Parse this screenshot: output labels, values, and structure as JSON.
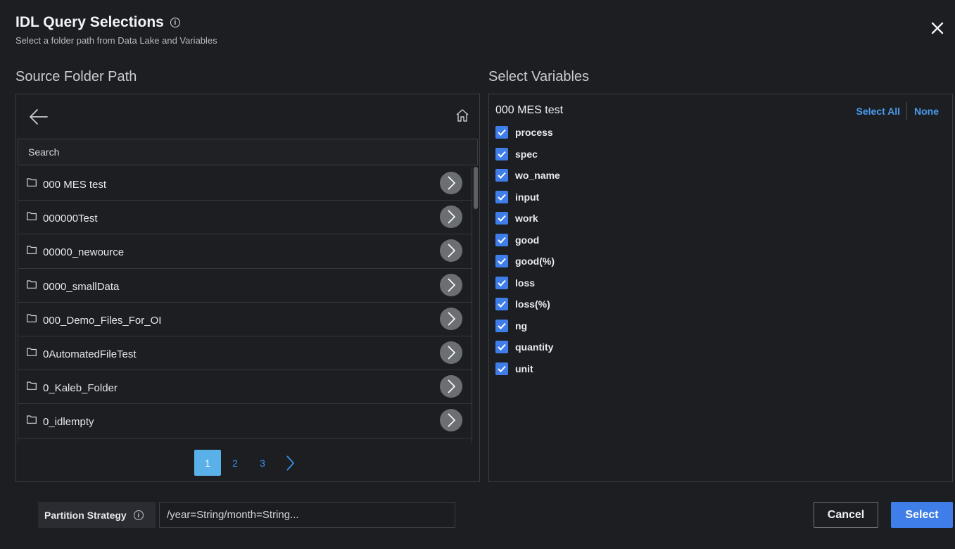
{
  "header": {
    "title": "IDL Query Selections",
    "subtitle": "Select a folder path from Data Lake and Variables"
  },
  "source": {
    "section_title": "Source Folder Path",
    "search_placeholder": "Search",
    "folders": [
      {
        "label": "000 MES test"
      },
      {
        "label": "000000Test"
      },
      {
        "label": "00000_newource"
      },
      {
        "label": "0000_smallData"
      },
      {
        "label": "000_Demo_Files_For_OI"
      },
      {
        "label": "0AutomatedFileTest"
      },
      {
        "label": "0_Kaleb_Folder"
      },
      {
        "label": "0_idlempty"
      }
    ],
    "pages": [
      "1",
      "2",
      "3"
    ],
    "current_page": "1"
  },
  "variables": {
    "section_title": "Select Variables",
    "folder_name": "000 MES test",
    "select_all_label": "Select All",
    "none_label": "None",
    "items": [
      {
        "label": "process",
        "checked": true
      },
      {
        "label": "spec",
        "checked": true
      },
      {
        "label": "wo_name",
        "checked": true
      },
      {
        "label": "input",
        "checked": true
      },
      {
        "label": "work",
        "checked": true
      },
      {
        "label": "good",
        "checked": true
      },
      {
        "label": "good(%)",
        "checked": true
      },
      {
        "label": "loss",
        "checked": true
      },
      {
        "label": "loss(%)",
        "checked": true
      },
      {
        "label": "ng",
        "checked": true
      },
      {
        "label": "quantity",
        "checked": true
      },
      {
        "label": "unit",
        "checked": true
      }
    ]
  },
  "footer": {
    "partition_label": "Partition Strategy",
    "partition_placeholder": "/year=String/month=String...",
    "cancel_label": "Cancel",
    "select_label": "Select"
  },
  "colors": {
    "accent": "#3f7ee8",
    "link": "#4a9cf0",
    "background": "#1c1e22"
  }
}
